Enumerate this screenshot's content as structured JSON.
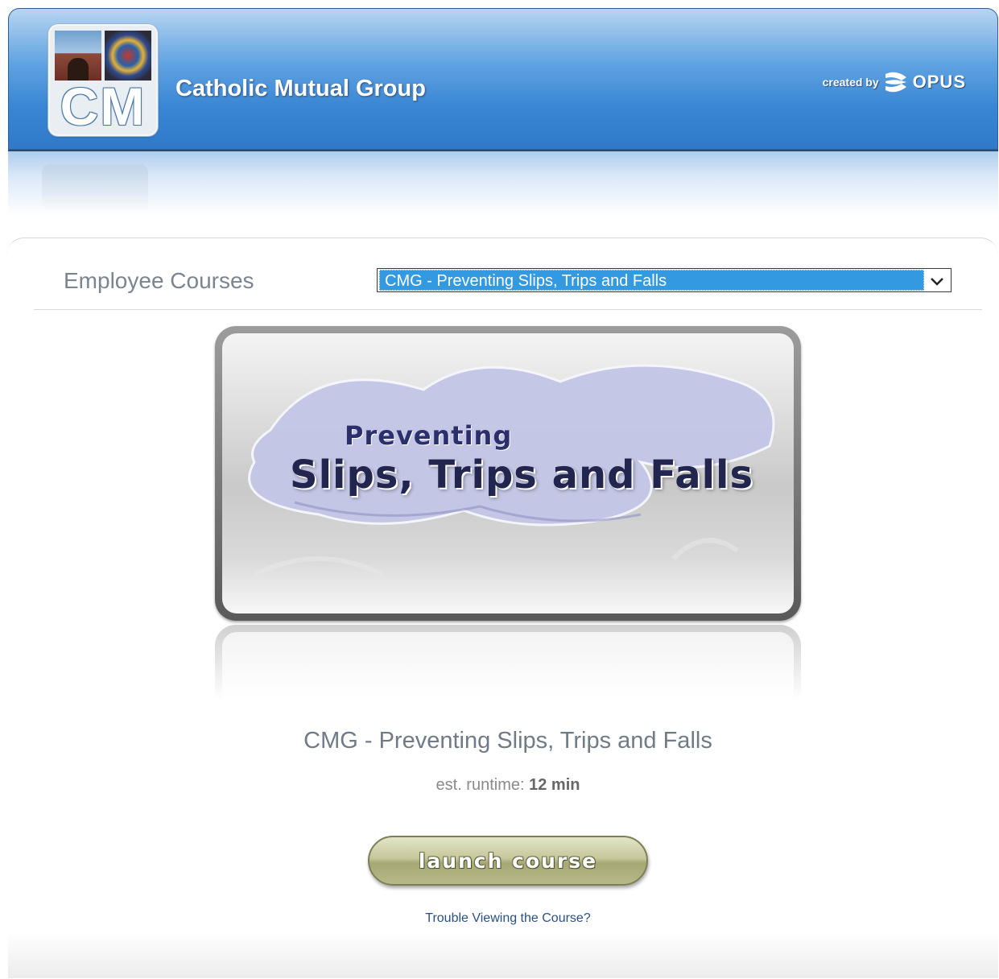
{
  "header": {
    "company_name": "Catholic Mutual Group",
    "logo_letters": "CM",
    "created_by_label": "created by",
    "vendor_name": "OPUS"
  },
  "courses": {
    "section_label": "Employee Courses",
    "selected_course": "CMG - Preventing Slips, Trips and Falls"
  },
  "course_image": {
    "line1": "Preventing",
    "line2": "Slips, Trips and Falls"
  },
  "course_info": {
    "title": "CMG - Preventing Slips, Trips and Falls",
    "runtime_label": "est. runtime:",
    "runtime_value": "12 min"
  },
  "actions": {
    "launch_label": "launch course",
    "trouble_link": "Trouble Viewing the Course?"
  },
  "icons": {
    "dropdown": "chevron-down-icon",
    "vendor": "opus-logo-icon"
  },
  "colors": {
    "header_blue": "#3a86d4",
    "selected_option_bg": "#3399e0",
    "launch_button": "#b7b98a",
    "link_color": "#2a4f86"
  }
}
